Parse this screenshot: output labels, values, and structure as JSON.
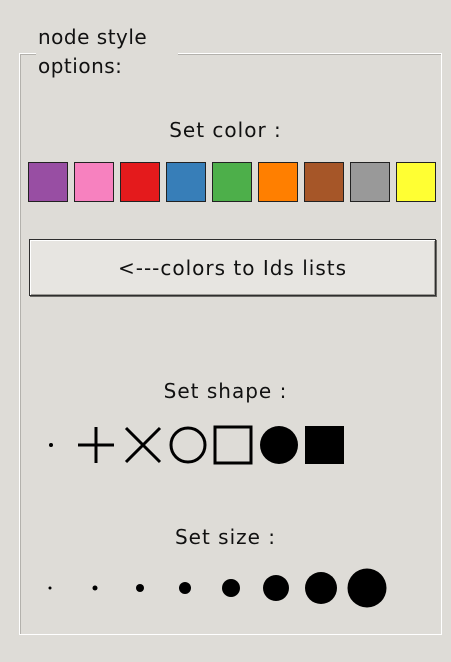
{
  "group": {
    "title": "node style options:"
  },
  "color_section": {
    "label": "Set color :",
    "swatches": [
      {
        "name": "purple",
        "color": "#984ea3"
      },
      {
        "name": "pink",
        "color": "#f781bf"
      },
      {
        "name": "red",
        "color": "#e41a1c"
      },
      {
        "name": "blue",
        "color": "#377eb8"
      },
      {
        "name": "green",
        "color": "#4daf4a"
      },
      {
        "name": "orange",
        "color": "#ff7f00"
      },
      {
        "name": "brown",
        "color": "#a65628"
      },
      {
        "name": "gray",
        "color": "#999999"
      },
      {
        "name": "yellow",
        "color": "#ffff33"
      }
    ]
  },
  "map_button": {
    "label": "<---colors to Ids lists"
  },
  "shape_section": {
    "label": "Set shape :",
    "shapes": [
      "point-icon",
      "plus-icon",
      "cross-icon",
      "circle-outline-icon",
      "square-outline-icon",
      "filled-circle-icon",
      "filled-square-icon"
    ]
  },
  "size_section": {
    "label": "Set size :",
    "sizes": [
      1,
      2,
      3,
      4,
      5,
      6,
      7,
      8
    ]
  }
}
